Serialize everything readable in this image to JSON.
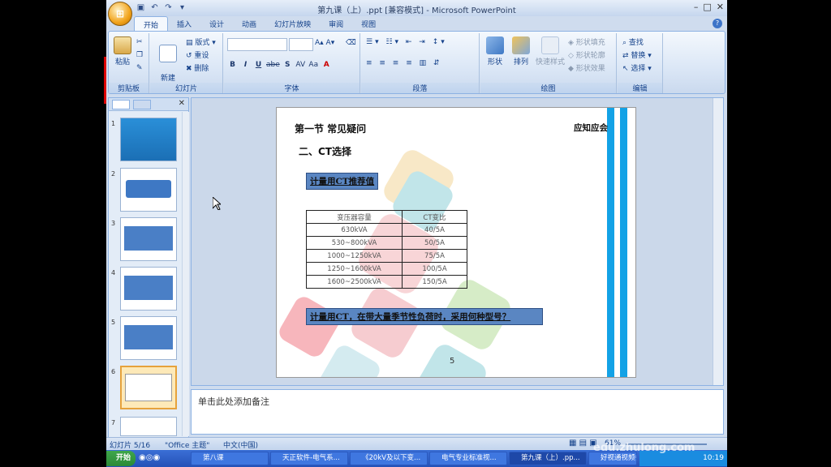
{
  "window": {
    "title": "第九课（上）.ppt [兼容模式] - Microsoft PowerPoint"
  },
  "tabs": [
    "开始",
    "插入",
    "设计",
    "动画",
    "幻灯片放映",
    "审阅",
    "视图"
  ],
  "ribbon": {
    "clipboard": {
      "paste": "粘贴",
      "label": "剪贴板"
    },
    "slides": {
      "new_slide": "新建\n幻灯片",
      "layout": "版式",
      "reset": "重设",
      "delete": "删除",
      "label": "幻灯片"
    },
    "font": {
      "label": "字体",
      "bold": "B",
      "italic": "I",
      "underline": "U",
      "strike": "abe",
      "shadow": "S",
      "spacing": "AV",
      "case": "Aa",
      "color": "A"
    },
    "paragraph": {
      "label": "段落"
    },
    "drawing": {
      "shape": "形状",
      "arrange": "排列",
      "quick_styles": "快速样式",
      "shape_fill": "形状填充",
      "shape_outline": "形状轮廓",
      "shape_effects": "形状效果",
      "label": "绘图"
    },
    "editing": {
      "find": "查找",
      "replace": "替换",
      "select": "选择",
      "label": "编辑"
    }
  },
  "thumbnails": [
    "1",
    "2",
    "3",
    "4",
    "5",
    "6",
    "7"
  ],
  "slide": {
    "heading": "第一节 常见疑问",
    "subheading": "二、CT选择",
    "corner": "应知应会",
    "box1": "计量用CT推荐值",
    "table": {
      "headers": [
        "变压器容量",
        "CT变比"
      ],
      "rows": [
        [
          "630kVA",
          "40/5A"
        ],
        [
          "530~800kVA",
          "50/5A"
        ],
        [
          "1000~1250kVA",
          "75/5A"
        ],
        [
          "1250~1600kVA",
          "100/5A"
        ],
        [
          "1600~2500kVA",
          "150/5A"
        ]
      ]
    },
    "box2": "计量用CT，在带大量季节性负荷时，采用何种型号？",
    "page": "5"
  },
  "notes_placeholder": "单击此处添加备注",
  "status": {
    "slide": "幻灯片 5/16",
    "theme": "\"Office 主题\"",
    "lang": "中文(中国)",
    "zoom": "61%"
  },
  "taskbar": {
    "start": "开始",
    "items": [
      "第八课",
      "天正软件-电气系...",
      "《20kV及以下变...",
      "电气专业标准视...",
      "第九课（上）.pp..."
    ],
    "tray_text": "好视通视频会议",
    "time": "10:19"
  },
  "watermark": "edu.zhulong.com"
}
